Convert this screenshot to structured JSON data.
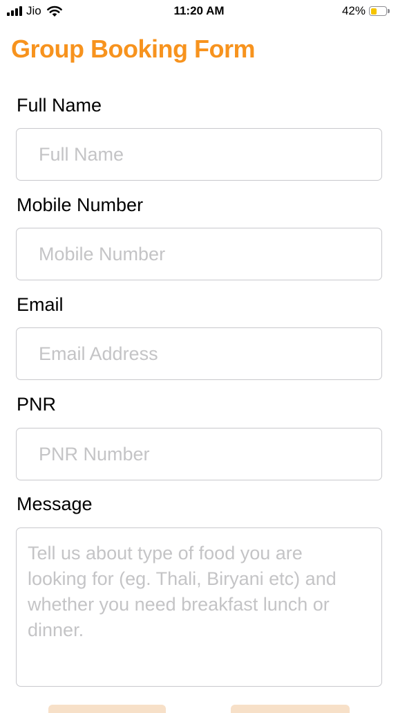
{
  "status_bar": {
    "carrier": "Jio",
    "time": "11:20 AM",
    "battery_percent": "42%",
    "battery_level": 0.42,
    "battery_color": "#f5c400"
  },
  "form": {
    "title": "Group Booking Form",
    "title_color": "#f7931e",
    "fields": [
      {
        "label": "Full Name",
        "placeholder": "Full Name"
      },
      {
        "label": "Mobile Number",
        "placeholder": "Mobile Number"
      },
      {
        "label": "Email",
        "placeholder": "Email Address"
      },
      {
        "label": "PNR",
        "placeholder": "PNR Number"
      }
    ],
    "message": {
      "label": "Message",
      "placeholder": "Tell us about type of food you are looking for (eg. Thali, Biryani etc) and whether you need breakfast lunch or dinner."
    }
  },
  "icons": {
    "signal": "signal-bars-icon",
    "wifi": "wifi-icon",
    "battery": "battery-icon"
  }
}
